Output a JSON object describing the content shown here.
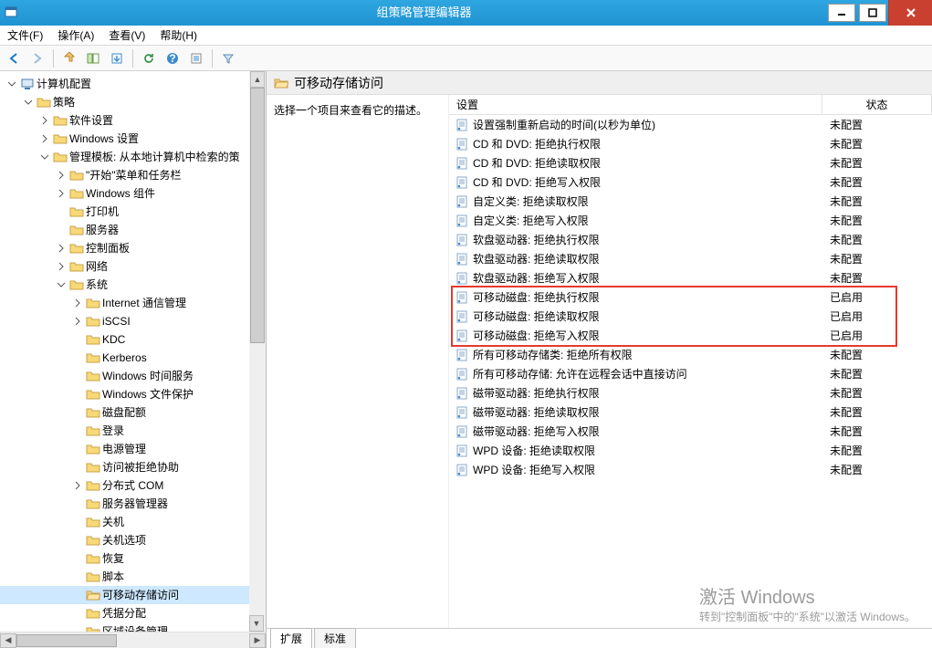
{
  "window": {
    "title": "组策略管理编辑器"
  },
  "menu": {
    "file": "文件(F)",
    "action": "操作(A)",
    "view": "查看(V)",
    "help": "帮助(H)"
  },
  "tree": [
    {
      "depth": 0,
      "tw": "open",
      "icon": "computer",
      "label": "计算机配置"
    },
    {
      "depth": 1,
      "tw": "open",
      "icon": "folder",
      "label": "策略"
    },
    {
      "depth": 2,
      "tw": "closed",
      "icon": "folder",
      "label": "软件设置"
    },
    {
      "depth": 2,
      "tw": "closed",
      "icon": "folder",
      "label": "Windows 设置"
    },
    {
      "depth": 2,
      "tw": "open",
      "icon": "folder",
      "label": "管理模板: 从本地计算机中检索的策"
    },
    {
      "depth": 3,
      "tw": "closed",
      "icon": "folder",
      "label": "\"开始\"菜单和任务栏"
    },
    {
      "depth": 3,
      "tw": "closed",
      "icon": "folder",
      "label": "Windows 组件"
    },
    {
      "depth": 3,
      "tw": "none",
      "icon": "folder",
      "label": "打印机"
    },
    {
      "depth": 3,
      "tw": "none",
      "icon": "folder",
      "label": "服务器"
    },
    {
      "depth": 3,
      "tw": "closed",
      "icon": "folder",
      "label": "控制面板"
    },
    {
      "depth": 3,
      "tw": "closed",
      "icon": "folder",
      "label": "网络"
    },
    {
      "depth": 3,
      "tw": "open",
      "icon": "folder",
      "label": "系统"
    },
    {
      "depth": 4,
      "tw": "closed",
      "icon": "folder",
      "label": "Internet 通信管理"
    },
    {
      "depth": 4,
      "tw": "closed",
      "icon": "folder",
      "label": "iSCSI"
    },
    {
      "depth": 4,
      "tw": "none",
      "icon": "folder",
      "label": "KDC"
    },
    {
      "depth": 4,
      "tw": "none",
      "icon": "folder",
      "label": "Kerberos"
    },
    {
      "depth": 4,
      "tw": "none",
      "icon": "folder",
      "label": "Windows 时间服务"
    },
    {
      "depth": 4,
      "tw": "none",
      "icon": "folder",
      "label": "Windows 文件保护"
    },
    {
      "depth": 4,
      "tw": "none",
      "icon": "folder",
      "label": "磁盘配额"
    },
    {
      "depth": 4,
      "tw": "none",
      "icon": "folder",
      "label": "登录"
    },
    {
      "depth": 4,
      "tw": "none",
      "icon": "folder",
      "label": "电源管理"
    },
    {
      "depth": 4,
      "tw": "none",
      "icon": "folder",
      "label": "访问被拒绝协助"
    },
    {
      "depth": 4,
      "tw": "closed",
      "icon": "folder",
      "label": "分布式 COM"
    },
    {
      "depth": 4,
      "tw": "none",
      "icon": "folder",
      "label": "服务器管理器"
    },
    {
      "depth": 4,
      "tw": "none",
      "icon": "folder",
      "label": "关机"
    },
    {
      "depth": 4,
      "tw": "none",
      "icon": "folder",
      "label": "关机选项"
    },
    {
      "depth": 4,
      "tw": "none",
      "icon": "folder",
      "label": "恢复"
    },
    {
      "depth": 4,
      "tw": "none",
      "icon": "folder",
      "label": "脚本"
    },
    {
      "depth": 4,
      "tw": "none",
      "icon": "folder-open",
      "label": "可移动存储访问",
      "selected": true
    },
    {
      "depth": 4,
      "tw": "none",
      "icon": "folder",
      "label": "凭据分配"
    },
    {
      "depth": 4,
      "tw": "none",
      "icon": "folder",
      "label": "区域设备管理"
    }
  ],
  "content": {
    "heading": "可移动存储访问",
    "desc": "选择一个项目来查看它的描述。",
    "columns": {
      "setting": "设置",
      "status": "状态"
    },
    "rows": [
      {
        "name": "设置强制重新启动的时间(以秒为单位)",
        "status": "未配置"
      },
      {
        "name": "CD 和 DVD: 拒绝执行权限",
        "status": "未配置"
      },
      {
        "name": "CD 和 DVD: 拒绝读取权限",
        "status": "未配置"
      },
      {
        "name": "CD 和 DVD: 拒绝写入权限",
        "status": "未配置"
      },
      {
        "name": "自定义类: 拒绝读取权限",
        "status": "未配置"
      },
      {
        "name": "自定义类: 拒绝写入权限",
        "status": "未配置"
      },
      {
        "name": "软盘驱动器: 拒绝执行权限",
        "status": "未配置"
      },
      {
        "name": "软盘驱动器: 拒绝读取权限",
        "status": "未配置"
      },
      {
        "name": "软盘驱动器: 拒绝写入权限",
        "status": "未配置"
      },
      {
        "name": "可移动磁盘: 拒绝执行权限",
        "status": "已启用",
        "hl": true
      },
      {
        "name": "可移动磁盘: 拒绝读取权限",
        "status": "已启用",
        "hl": true
      },
      {
        "name": "可移动磁盘: 拒绝写入权限",
        "status": "已启用",
        "hl": true
      },
      {
        "name": "所有可移动存储类: 拒绝所有权限",
        "status": "未配置"
      },
      {
        "name": "所有可移动存储: 允许在远程会话中直接访问",
        "status": "未配置"
      },
      {
        "name": "磁带驱动器: 拒绝执行权限",
        "status": "未配置"
      },
      {
        "name": "磁带驱动器: 拒绝读取权限",
        "status": "未配置"
      },
      {
        "name": "磁带驱动器: 拒绝写入权限",
        "status": "未配置"
      },
      {
        "name": "WPD 设备: 拒绝读取权限",
        "status": "未配置"
      },
      {
        "name": "WPD 设备: 拒绝写入权限",
        "status": "未配置"
      }
    ]
  },
  "tabs": {
    "extended": "扩展",
    "standard": "标准"
  },
  "watermark": {
    "t1": "激活 Windows",
    "t2": "转到\"控制面板\"中的\"系统\"以激活 Windows。"
  }
}
